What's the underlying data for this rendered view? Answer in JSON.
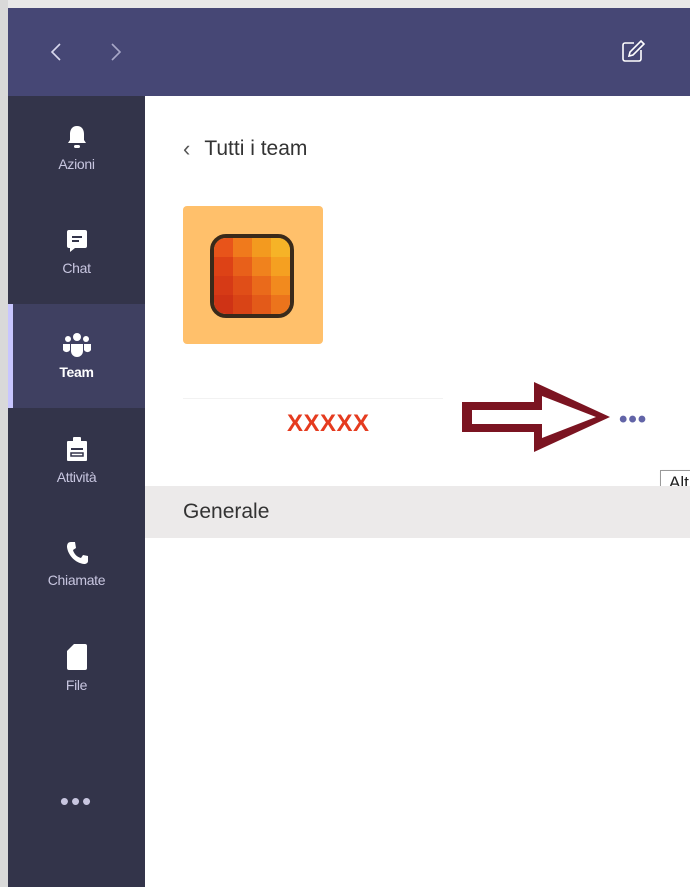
{
  "titlebar": {
    "back_icon": "chevron-left-icon",
    "forward_icon": "chevron-right-icon",
    "compose_icon": "compose-icon"
  },
  "rail": {
    "items": [
      {
        "label": "Azioni",
        "icon": "bell-icon"
      },
      {
        "label": "Chat",
        "icon": "chat-icon"
      },
      {
        "label": "Team",
        "icon": "team-icon",
        "active": true
      },
      {
        "label": "Attività",
        "icon": "briefcase-icon"
      },
      {
        "label": "Chiamate",
        "icon": "phone-icon"
      },
      {
        "label": "File",
        "icon": "file-icon"
      }
    ],
    "more": "•••"
  },
  "main": {
    "back_label": "Tutti i team",
    "team_name": "XXXXX",
    "more_options": "•••",
    "tooltip": "Altr",
    "channels": [
      {
        "label": "Generale"
      }
    ]
  },
  "colors": {
    "titlebar": "#464775",
    "rail": "#33344a",
    "accent": "#6264a7",
    "tile": "#ffc06b",
    "annotation_red": "#e53b1f",
    "arrow": "#7b1421"
  }
}
